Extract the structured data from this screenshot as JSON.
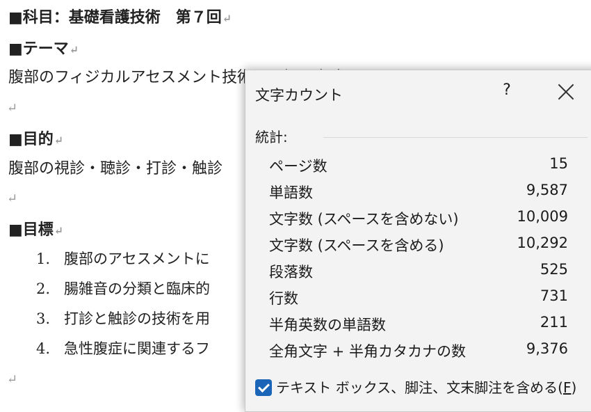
{
  "document": {
    "para_mark": "↵",
    "heading1": "■科目：基礎看護技術　第７回",
    "heading2": "■テーマ",
    "theme_text": "腹部のフィジカルアセスメント技術の理解と実践",
    "heading3": "■目的",
    "purpose_text": "腹部の視診・聴診・打診・触診",
    "heading4": "■目標",
    "goals": [
      {
        "num": "1.",
        "text": "腹部のアセスメントに"
      },
      {
        "num": "2.",
        "text": "腸雑音の分類と臨床的"
      },
      {
        "num": "3.",
        "text": "打診と触診の技術を用"
      },
      {
        "num": "4.",
        "text": "急性腹症に関連するフ"
      }
    ]
  },
  "dialog": {
    "title": "文字カウント",
    "help": "?",
    "section": "統計:",
    "stats": [
      {
        "label": "ページ数",
        "value": "15"
      },
      {
        "label": "単語数",
        "value": "9,587"
      },
      {
        "label": "文字数 (スペースを含めない)",
        "value": "10,009"
      },
      {
        "label": "文字数 (スペースを含める)",
        "value": "10,292"
      },
      {
        "label": "段落数",
        "value": "525"
      },
      {
        "label": "行数",
        "value": "731"
      },
      {
        "label": "半角英数の単語数",
        "value": "211"
      },
      {
        "label": "全角文字 + 半角カタカナの数",
        "value": "9,376"
      }
    ],
    "checkbox_label": "テキスト ボックス、脚注、文末脚注を含める(",
    "checkbox_key": "F",
    "checkbox_end": ")",
    "checkbox_checked": true,
    "accent": "#1a65b7"
  }
}
